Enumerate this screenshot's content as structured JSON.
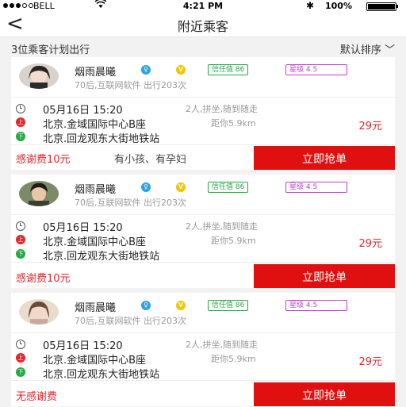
{
  "status_bar": {
    "carrier": "BELL",
    "time": "4:21 PM",
    "battery": "100%"
  },
  "nav": {
    "back": "<",
    "title": "附近乘客"
  },
  "subheader": {
    "count": "3位乘客计划出行",
    "sort": "默认排序"
  },
  "cards": [
    {
      "name": "烟雨晨曦",
      "trust": "信任值 86",
      "star": "星级 4.5",
      "meta": "70后,互联网软件    出行203次",
      "time": "05月16日  15:20",
      "seats": "2人,拼坐,随到随走",
      "from": "北京.金域国际中心B座",
      "distance": "距你5.9km",
      "price": "29元",
      "to": "北京.回龙观东大街地铁站",
      "fee": "感谢费10元",
      "note": "有小孩、有孕妇",
      "action": "立即抢单"
    },
    {
      "name": "烟雨晨曦",
      "trust": "信任值 86",
      "star": "星级 4.5",
      "meta": "70后,互联网软件    出行203次",
      "time": "05月16日  15:20",
      "seats": "2人,拼坐,随到随走",
      "from": "北京.金域国际中心B座",
      "distance": "距你5.9km",
      "price": "29元",
      "to": "北京.回龙观东大街地铁站",
      "fee": "感谢费10元",
      "note": "",
      "action": "立即抢单"
    },
    {
      "name": "烟雨晨曦",
      "trust": "信任值 86",
      "star": "星级 4.5",
      "meta": "70后,互联网软件    出行203次",
      "time": "05月16日  15:20",
      "seats": "2人,拼坐,随到随走",
      "from": "北京.金域国际中心B座",
      "distance": "距你5.9km",
      "price": "29元",
      "to": "北京.回龙观东大街地铁站",
      "fee": "无感谢费",
      "note": "",
      "action": "立即抢单"
    }
  ],
  "icons": {
    "gender": "female-icon",
    "vip": "vip-icon",
    "start": "pickup-marker-icon",
    "end": "dropoff-marker-icon",
    "time": "clock-icon"
  },
  "colors": {
    "accent": "#e01010",
    "price": "#e3262c",
    "trust": "#22aa44",
    "star": "#c040d0",
    "gender": "#2aa1e9",
    "vip": "#f5c400"
  }
}
